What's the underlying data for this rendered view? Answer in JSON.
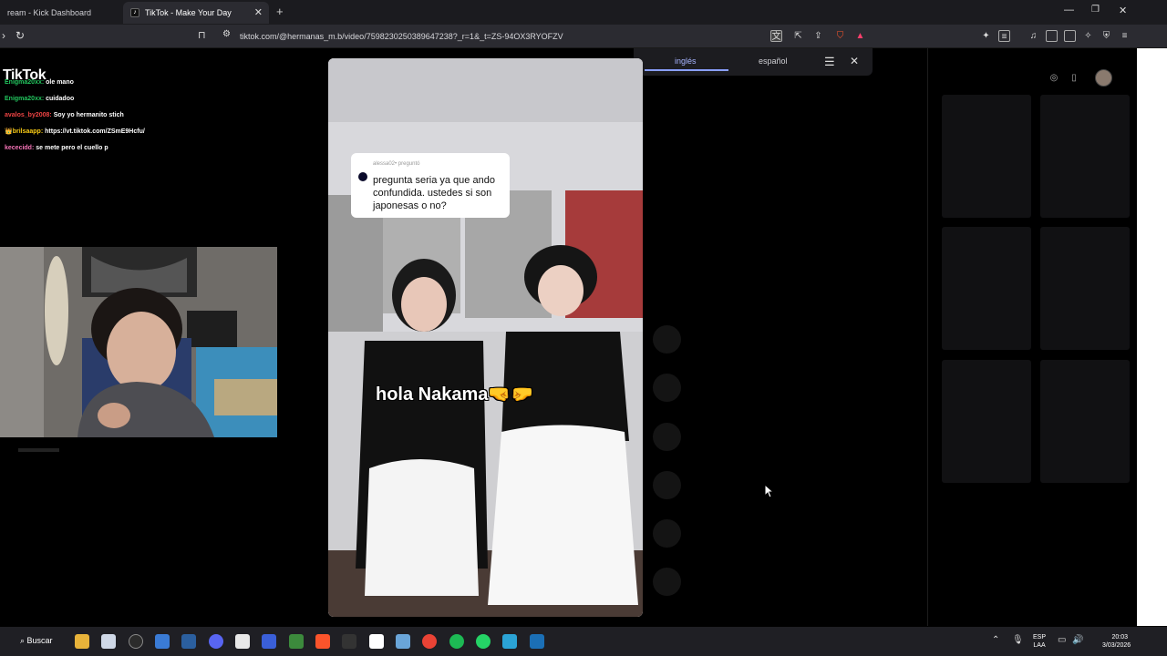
{
  "browser": {
    "tabs": [
      {
        "label": "ream - Kick Dashboard",
        "active": false
      },
      {
        "label": "TikTok - Make Your Day",
        "active": true
      }
    ],
    "url": "tiktok.com/@hermanas_m.b/video/7598230250389647238?_r=1&_t=ZS-94OX3RYOFZV",
    "icons": [
      "back-icon",
      "reload-icon",
      "bookmark-icon",
      "site-settings-icon",
      "translate-icon",
      "open-external-icon",
      "share-icon",
      "brave-shields-icon",
      "brave-rewards-icon",
      "extensions-icon",
      "media-icon",
      "sidebar-icon",
      "wallet-icon",
      "leo-icon",
      "vpn-icon",
      "menu-icon"
    ]
  },
  "translate_popup": {
    "source_lang": "inglés",
    "target_lang": "español"
  },
  "stream_overlay": {
    "logo_text": "TikTok",
    "chat": [
      {
        "user": "Enigma20xx:",
        "msg": "ole mano",
        "color": "#22c55e"
      },
      {
        "user": "Enigma20xx:",
        "msg": "cuidadoo",
        "color": "#22c55e"
      },
      {
        "user": "avalos_by2008:",
        "msg": "Soy yo hermanito stich",
        "color": "#ef4444"
      },
      {
        "user": "👑brilsaapp:",
        "msg": "https://vt.tiktok.com/ZSmE9Hcfu/",
        "color": "#facc15"
      },
      {
        "user": "kececidd:",
        "msg": "se mete pero el cuello p",
        "color": "#f472b6"
      }
    ]
  },
  "video": {
    "question_header": "alessa02• preguntó",
    "question_text": "pregunta seria ya que ando confundida. ustedes si son japonesas o no?",
    "caption": "hola Nakama🤜🤛"
  },
  "taskbar": {
    "search_label": "Buscar",
    "lang_line1": "ESP",
    "lang_line2": "LAA",
    "time": "20:03",
    "date": "3/03/2026"
  }
}
